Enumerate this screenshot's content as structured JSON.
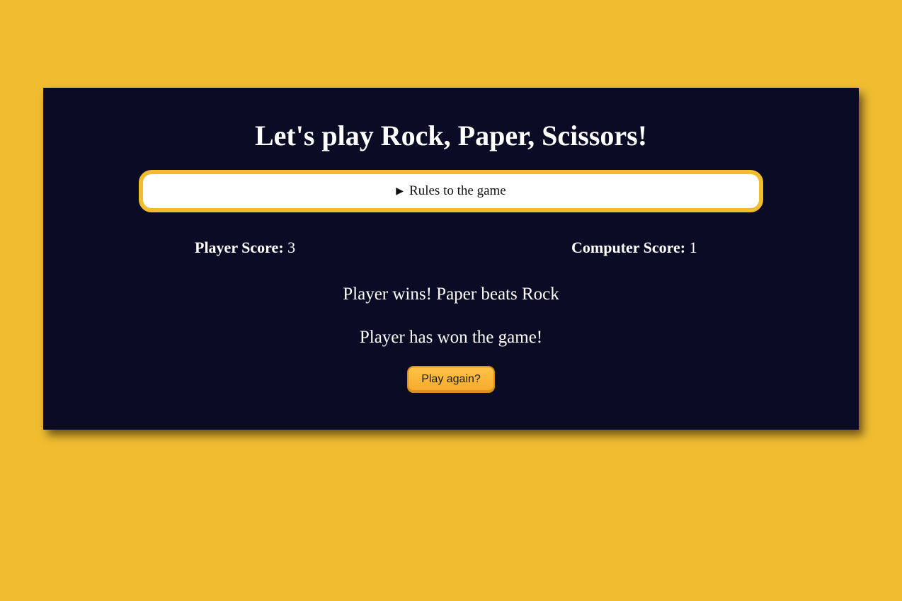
{
  "game": {
    "title": "Let's play Rock, Paper, Scissors!",
    "rules_summary": "Rules to the game",
    "rules_icon": "triangle-right-icon",
    "player_score_label": "Player Score:",
    "player_score": "3",
    "computer_score_label": "Computer Score:",
    "computer_score": "1",
    "round_result": "Player wins! Paper beats Rock",
    "final_result": "Player has won the game!",
    "play_again_label": "Play again?"
  },
  "colors": {
    "background": "#f0bd31",
    "panel": "#0a0b24",
    "accent": "#f7a92c",
    "text": "#ffffff"
  }
}
